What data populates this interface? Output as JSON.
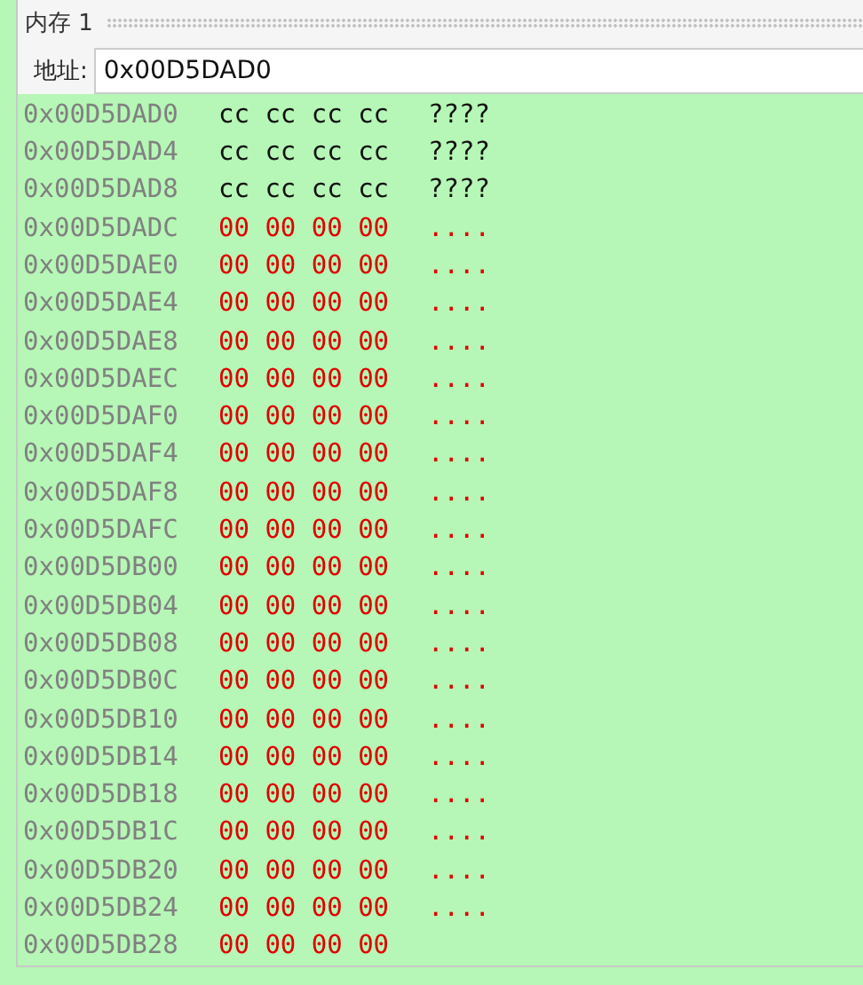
{
  "panel": {
    "title": "内存 1"
  },
  "address_bar": {
    "label": "地址:",
    "value": "0x00D5DAD0"
  },
  "rows": [
    {
      "address": "0x00D5DAD0",
      "bytes": "cc cc cc cc",
      "ascii": "????",
      "changed": false
    },
    {
      "address": "0x00D5DAD4",
      "bytes": "cc cc cc cc",
      "ascii": "????",
      "changed": false
    },
    {
      "address": "0x00D5DAD8",
      "bytes": "cc cc cc cc",
      "ascii": "????",
      "changed": false
    },
    {
      "address": "0x00D5DADC",
      "bytes": "00 00 00 00",
      "ascii": "....",
      "changed": true
    },
    {
      "address": "0x00D5DAE0",
      "bytes": "00 00 00 00",
      "ascii": "....",
      "changed": true
    },
    {
      "address": "0x00D5DAE4",
      "bytes": "00 00 00 00",
      "ascii": "....",
      "changed": true
    },
    {
      "address": "0x00D5DAE8",
      "bytes": "00 00 00 00",
      "ascii": "....",
      "changed": true
    },
    {
      "address": "0x00D5DAEC",
      "bytes": "00 00 00 00",
      "ascii": "....",
      "changed": true
    },
    {
      "address": "0x00D5DAF0",
      "bytes": "00 00 00 00",
      "ascii": "....",
      "changed": true
    },
    {
      "address": "0x00D5DAF4",
      "bytes": "00 00 00 00",
      "ascii": "....",
      "changed": true
    },
    {
      "address": "0x00D5DAF8",
      "bytes": "00 00 00 00",
      "ascii": "....",
      "changed": true
    },
    {
      "address": "0x00D5DAFC",
      "bytes": "00 00 00 00",
      "ascii": "....",
      "changed": true
    },
    {
      "address": "0x00D5DB00",
      "bytes": "00 00 00 00",
      "ascii": "....",
      "changed": true
    },
    {
      "address": "0x00D5DB04",
      "bytes": "00 00 00 00",
      "ascii": "....",
      "changed": true
    },
    {
      "address": "0x00D5DB08",
      "bytes": "00 00 00 00",
      "ascii": "....",
      "changed": true
    },
    {
      "address": "0x00D5DB0C",
      "bytes": "00 00 00 00",
      "ascii": "....",
      "changed": true
    },
    {
      "address": "0x00D5DB10",
      "bytes": "00 00 00 00",
      "ascii": "....",
      "changed": true
    },
    {
      "address": "0x00D5DB14",
      "bytes": "00 00 00 00",
      "ascii": "....",
      "changed": true
    },
    {
      "address": "0x00D5DB18",
      "bytes": "00 00 00 00",
      "ascii": "....",
      "changed": true
    },
    {
      "address": "0x00D5DB1C",
      "bytes": "00 00 00 00",
      "ascii": "....",
      "changed": true
    },
    {
      "address": "0x00D5DB20",
      "bytes": "00 00 00 00",
      "ascii": "....",
      "changed": true
    },
    {
      "address": "0x00D5DB24",
      "bytes": "00 00 00 00",
      "ascii": "....",
      "changed": true
    },
    {
      "address": "0x00D5DB28",
      "bytes": "00 00 00 00",
      "changed": true
    }
  ]
}
